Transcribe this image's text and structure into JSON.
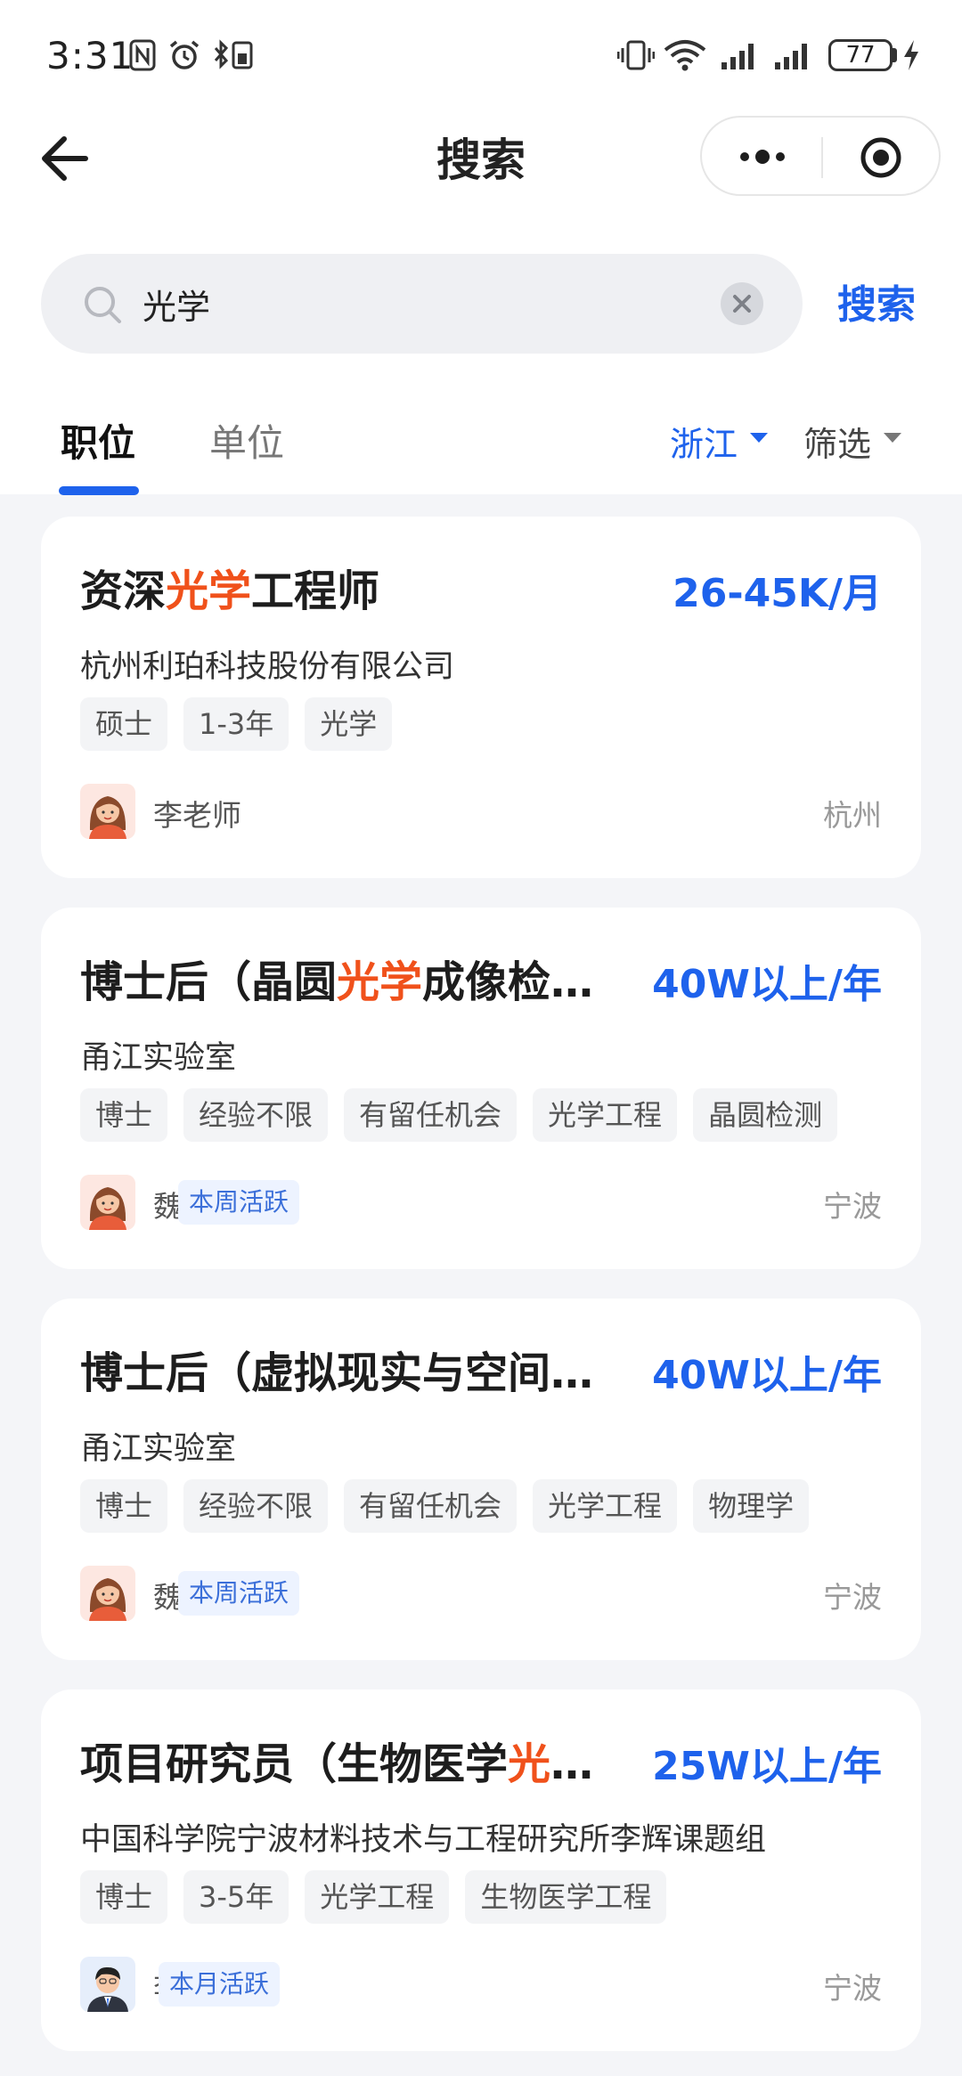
{
  "status_bar": {
    "time": "3:31",
    "battery": "77"
  },
  "nav": {
    "title": "搜索"
  },
  "search": {
    "query": "光学",
    "button_label": "搜索"
  },
  "tabs": {
    "items": [
      {
        "label": "职位",
        "active": true
      },
      {
        "label": "单位",
        "active": false
      }
    ],
    "region_filter": "浙江",
    "filter_label": "筛选"
  },
  "colors": {
    "accent": "#1e62ec",
    "highlight": "#f0511b"
  },
  "jobs": [
    {
      "title_pre": "资深",
      "title_hl": "光学",
      "title_post": "工程师",
      "salary": "26-45K/月",
      "company": "杭州利珀科技股份有限公司",
      "tags": [
        "硕士",
        "1-3年",
        "光学"
      ],
      "recruiter": "李老师",
      "badge": "",
      "city": "杭州",
      "avatar": "female-avatar-icon"
    },
    {
      "title_pre": "博士后（晶圆",
      "title_hl": "光学",
      "title_post": "成像检…",
      "salary": "40W以上/年",
      "company": "甬江实验室",
      "tags": [
        "博士",
        "经验不限",
        "有留任机会",
        "光学工程",
        "晶圆检测"
      ],
      "recruiter": "魏老师",
      "badge": "本周活跃",
      "city": "宁波",
      "avatar": "female-avatar-icon"
    },
    {
      "title_pre": "博士后（虚拟现实与空间…",
      "title_hl": "",
      "title_post": "",
      "salary": "40W以上/年",
      "company": "甬江实验室",
      "tags": [
        "博士",
        "经验不限",
        "有留任机会",
        "光学工程",
        "物理学"
      ],
      "recruiter": "魏老师",
      "badge": "本周活跃",
      "city": "宁波",
      "avatar": "female-avatar-icon"
    },
    {
      "title_pre": "项目研究员（生物医学",
      "title_hl": "光",
      "title_post": "…",
      "salary": "25W以上/年",
      "company": "中国科学院宁波材料技术与工程研究所李辉课题组",
      "tags": [
        "博士",
        "3-5年",
        "光学工程",
        "生物医学工程"
      ],
      "recruiter": "李辉",
      "badge": "本月活跃",
      "city": "宁波",
      "avatar": "male-avatar-icon"
    }
  ]
}
